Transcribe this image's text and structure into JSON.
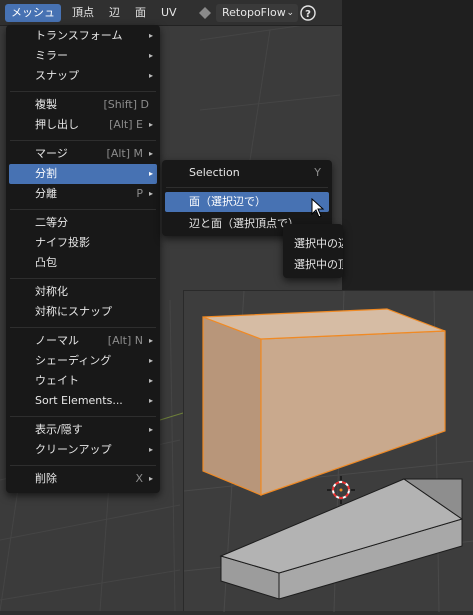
{
  "header": {
    "tabs": [
      {
        "label": "メッシュ",
        "active": true
      },
      {
        "label": "頂点",
        "active": false
      },
      {
        "label": "辺",
        "active": false
      },
      {
        "label": "面",
        "active": false
      },
      {
        "label": "UV",
        "active": false
      }
    ],
    "addon_dropdown": "RetopoFlow",
    "help_icon": "question-icon"
  },
  "mesh_menu": {
    "items": [
      {
        "label": "トランスフォーム",
        "shortcut": "",
        "submenu": true
      },
      {
        "label": "ミラー",
        "shortcut": "",
        "submenu": true
      },
      {
        "label": "スナップ",
        "shortcut": "",
        "submenu": true
      },
      {
        "label": "複製",
        "shortcut": "[Shift] D",
        "submenu": false
      },
      {
        "label": "押し出し",
        "shortcut": "[Alt] E",
        "submenu": true
      },
      {
        "label": "マージ",
        "shortcut": "[Alt] M",
        "submenu": true
      },
      {
        "label": "分割",
        "shortcut": "",
        "submenu": true,
        "highlighted": true
      },
      {
        "label": "分離",
        "shortcut": "P",
        "submenu": true
      },
      {
        "label": "二等分",
        "shortcut": "",
        "submenu": false
      },
      {
        "label": "ナイフ投影",
        "shortcut": "",
        "submenu": false
      },
      {
        "label": "凸包",
        "shortcut": "",
        "submenu": false
      },
      {
        "label": "対称化",
        "shortcut": "",
        "submenu": false
      },
      {
        "label": "対称にスナップ",
        "shortcut": "",
        "submenu": false
      },
      {
        "label": "ノーマル",
        "shortcut": "[Alt] N",
        "submenu": true
      },
      {
        "label": "シェーディング",
        "shortcut": "",
        "submenu": true
      },
      {
        "label": "ウェイト",
        "shortcut": "",
        "submenu": true
      },
      {
        "label": "Sort Elements...",
        "shortcut": "",
        "submenu": true
      },
      {
        "label": "表示/隠す",
        "shortcut": "",
        "submenu": true
      },
      {
        "label": "クリーンアップ",
        "shortcut": "",
        "submenu": true
      },
      {
        "label": "削除",
        "shortcut": "X",
        "submenu": true
      }
    ],
    "arrow_glyph": "▸"
  },
  "split_submenu": {
    "items": [
      {
        "label": "Selection",
        "shortcut": "Y"
      },
      {
        "label": "面（選択辺で）",
        "shortcut": "",
        "highlighted": true
      },
      {
        "label": "辺と面（選択頂点で）",
        "shortcut": ""
      }
    ]
  },
  "tooltip": {
    "lines": [
      "選択中の辺",
      "選択中の頂"
    ]
  },
  "colors": {
    "accent": "#4772b3",
    "menu_bg": "#181818",
    "selected_edge": "#f08a24",
    "selected_face": "#c9a98d"
  }
}
